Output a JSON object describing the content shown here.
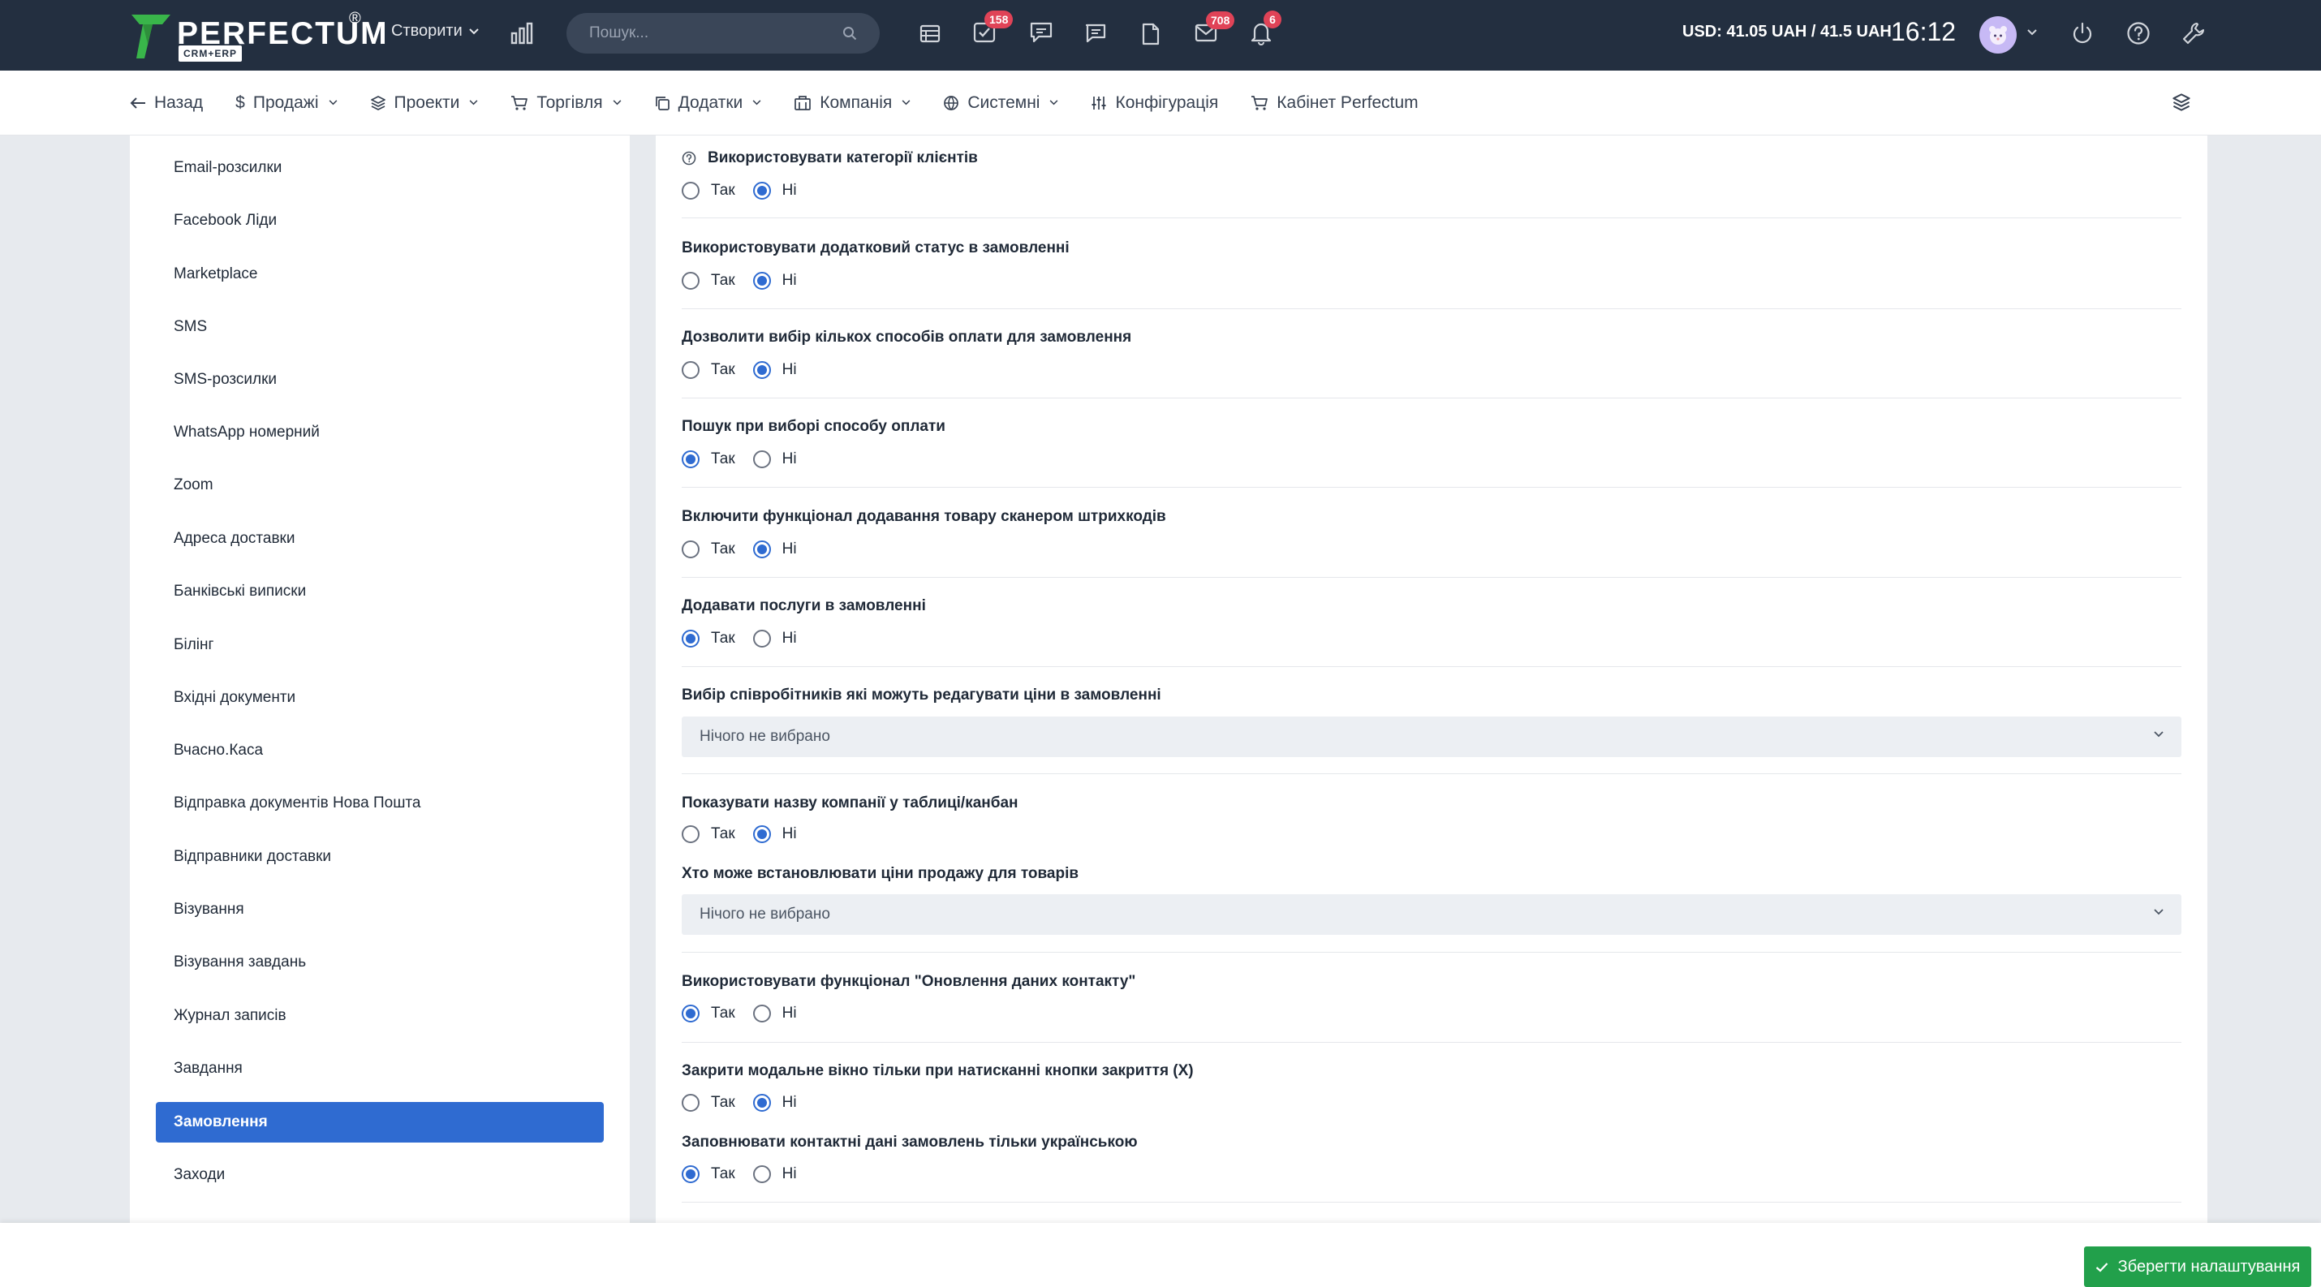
{
  "topbar": {
    "logo_text": "PERFECTUM",
    "logo_reg": "®",
    "logo_sub": "CRM+ERP",
    "create_label": "Створити",
    "search_placeholder": "Пошук...",
    "badges": {
      "tasks": "158",
      "mail": "708",
      "notifications": "6"
    },
    "currency": "USD: 41.05 UAH / 41.5 UAH",
    "time": "16:12"
  },
  "nav": {
    "back": "Назад",
    "items": [
      "Продажі",
      "Проекти",
      "Торгівля",
      "Додатки",
      "Компанія",
      "Системні",
      "Конфігурація",
      "Кабінет Perfectum"
    ]
  },
  "sidebar": {
    "items": [
      "Email-розсилки",
      "Facebook Ліди",
      "Marketplace",
      "SMS",
      "SMS-розсилки",
      "WhatsApp номерний",
      "Zoom",
      "Адреса доставки",
      "Банківські виписки",
      "Білінг",
      "Вхідні документи",
      "Вчасно.Каса",
      "Відправка документів Нова Пошта",
      "Відправники доставки",
      "Візування",
      "Візування завдань",
      "Журнал записів",
      "Завдання",
      "Замовлення",
      "Заходи"
    ],
    "active": "Замовлення"
  },
  "settings": {
    "yes": "Так",
    "no": "Ні",
    "items": [
      {
        "title": "Використовувати категорії клієнтів",
        "value": "Ні"
      },
      {
        "title": "Використовувати додатковий статус в замовленні",
        "value": "Ні"
      },
      {
        "title": "Дозволити вибір кількох способів оплати для замовлення",
        "value": "Ні"
      },
      {
        "title": "Пошук при виборі способу оплати",
        "value": "Так"
      },
      {
        "title": "Включити функціонал додавання товару сканером штрихкодів",
        "value": "Ні"
      },
      {
        "title": "Додавати послуги в замовленні",
        "value": "Так"
      },
      {
        "title": "Вибір співробітників які можуть редагувати ціни в замовленні",
        "select": "Нічого не вибрано"
      },
      {
        "title": "Показувати назву компанії у таблиці/канбан",
        "value": "Ні"
      },
      {
        "title": "Хто може встановлювати ціни продажу для товарів",
        "select": "Нічого не вибрано"
      },
      {
        "title": "Використовувати функціонал \"Оновлення даних контакту\"",
        "value": "Так"
      },
      {
        "title": "Закрити модальне вікно тільки при натисканні кнопки закриття (Х)",
        "value": "Ні"
      },
      {
        "title": "Заповнювати контактні дані замовлень тільки українською",
        "value": "Так"
      }
    ]
  },
  "footer": {
    "save_label": "Зберегти налаштування"
  },
  "colors": {
    "topbar": "#232f40",
    "accent": "#2f6bd1",
    "badge": "#e04357",
    "save": "#22a04b",
    "logo_green": "#39b54a"
  },
  "icons": [
    "logo-mark",
    "chart-icon",
    "search-icon",
    "calendar-icon",
    "tasks-icon",
    "chat-icon",
    "message-icon",
    "file-icon",
    "mail-icon",
    "bell-icon",
    "power-icon",
    "help-icon",
    "wrench-icon",
    "layers-icon",
    "check-icon"
  ]
}
